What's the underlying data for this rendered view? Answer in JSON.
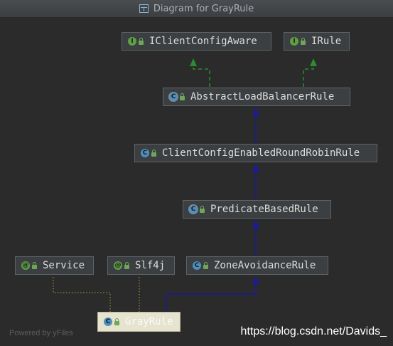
{
  "window": {
    "title": "Diagram for GrayRule"
  },
  "nodes": {
    "iclientconfigaware": {
      "label": "IClientConfigAware",
      "badge": "I"
    },
    "irule": {
      "label": "IRule",
      "badge": "I"
    },
    "abstractloadbalancerrule": {
      "label": "AbstractLoadBalancerRule",
      "badge": "C"
    },
    "clientconfigenabled": {
      "label": "ClientConfigEnabledRoundRobinRule",
      "badge": "C"
    },
    "predicatebasedrule": {
      "label": "PredicateBasedRule",
      "badge": "C"
    },
    "service": {
      "label": "Service",
      "badge": "@"
    },
    "slf4j": {
      "label": "Slf4j",
      "badge": "@"
    },
    "zoneavoidancerule": {
      "label": "ZoneAvoidanceRule",
      "badge": "C"
    },
    "grayrule": {
      "label": "GrayRule",
      "badge": "C"
    }
  },
  "footer": {
    "powered_by": "Powered by yFiles"
  },
  "watermark": "https://blog.csdn.net/Davids_",
  "colors": {
    "implements_edge": "#2e8b2e",
    "extends_edge": "#1a1a9a",
    "annotation_edge": "#8c8c3c",
    "selected_node": "#e6e3cf"
  }
}
